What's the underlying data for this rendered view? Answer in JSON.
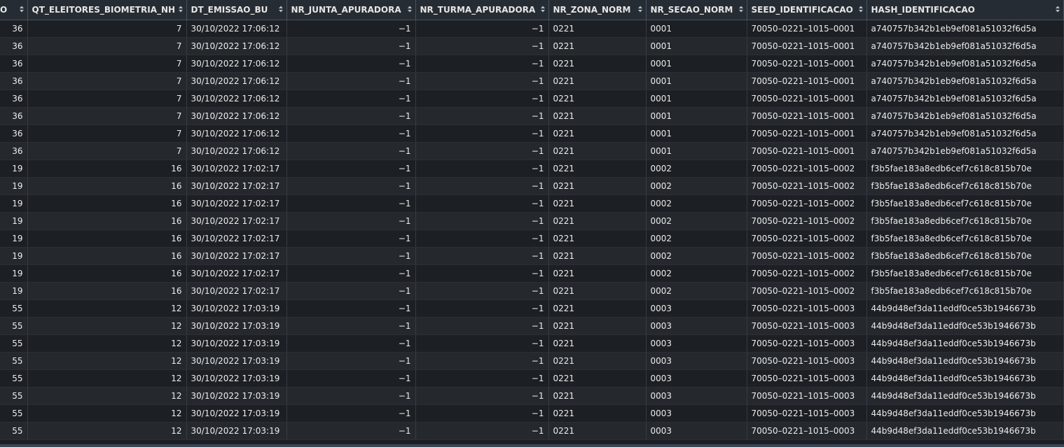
{
  "grid": {
    "columns": [
      {
        "label": "O"
      },
      {
        "label": "QT_ELEITORES_BIOMETRIA_NH"
      },
      {
        "label": "DT_EMISSAO_BU"
      },
      {
        "label": "NR_JUNTA_APURADORA"
      },
      {
        "label": "NR_TURMA_APURADORA"
      },
      {
        "label": "NR_ZONA_NORM"
      },
      {
        "label": "NR_SECAO_NORM"
      },
      {
        "label": "SEED_IDENTIFICACAO"
      },
      {
        "label": "HASH_IDENTIFICACAO"
      }
    ],
    "rows": [
      [
        "36",
        "7",
        "30/10/2022 17:06:12",
        "−1",
        "−1",
        "0221",
        "0001",
        "70050–0221–1015–0001",
        "a740757b342b1eb9ef081a51032f6d5a"
      ],
      [
        "36",
        "7",
        "30/10/2022 17:06:12",
        "−1",
        "−1",
        "0221",
        "0001",
        "70050–0221–1015–0001",
        "a740757b342b1eb9ef081a51032f6d5a"
      ],
      [
        "36",
        "7",
        "30/10/2022 17:06:12",
        "−1",
        "−1",
        "0221",
        "0001",
        "70050–0221–1015–0001",
        "a740757b342b1eb9ef081a51032f6d5a"
      ],
      [
        "36",
        "7",
        "30/10/2022 17:06:12",
        "−1",
        "−1",
        "0221",
        "0001",
        "70050–0221–1015–0001",
        "a740757b342b1eb9ef081a51032f6d5a"
      ],
      [
        "36",
        "7",
        "30/10/2022 17:06:12",
        "−1",
        "−1",
        "0221",
        "0001",
        "70050–0221–1015–0001",
        "a740757b342b1eb9ef081a51032f6d5a"
      ],
      [
        "36",
        "7",
        "30/10/2022 17:06:12",
        "−1",
        "−1",
        "0221",
        "0001",
        "70050–0221–1015–0001",
        "a740757b342b1eb9ef081a51032f6d5a"
      ],
      [
        "36",
        "7",
        "30/10/2022 17:06:12",
        "−1",
        "−1",
        "0221",
        "0001",
        "70050–0221–1015–0001",
        "a740757b342b1eb9ef081a51032f6d5a"
      ],
      [
        "36",
        "7",
        "30/10/2022 17:06:12",
        "−1",
        "−1",
        "0221",
        "0001",
        "70050–0221–1015–0001",
        "a740757b342b1eb9ef081a51032f6d5a"
      ],
      [
        "19",
        "16",
        "30/10/2022 17:02:17",
        "−1",
        "−1",
        "0221",
        "0002",
        "70050–0221–1015–0002",
        "f3b5fae183a8edb6cef7c618c815b70e"
      ],
      [
        "19",
        "16",
        "30/10/2022 17:02:17",
        "−1",
        "−1",
        "0221",
        "0002",
        "70050–0221–1015–0002",
        "f3b5fae183a8edb6cef7c618c815b70e"
      ],
      [
        "19",
        "16",
        "30/10/2022 17:02:17",
        "−1",
        "−1",
        "0221",
        "0002",
        "70050–0221–1015–0002",
        "f3b5fae183a8edb6cef7c618c815b70e"
      ],
      [
        "19",
        "16",
        "30/10/2022 17:02:17",
        "−1",
        "−1",
        "0221",
        "0002",
        "70050–0221–1015–0002",
        "f3b5fae183a8edb6cef7c618c815b70e"
      ],
      [
        "19",
        "16",
        "30/10/2022 17:02:17",
        "−1",
        "−1",
        "0221",
        "0002",
        "70050–0221–1015–0002",
        "f3b5fae183a8edb6cef7c618c815b70e"
      ],
      [
        "19",
        "16",
        "30/10/2022 17:02:17",
        "−1",
        "−1",
        "0221",
        "0002",
        "70050–0221–1015–0002",
        "f3b5fae183a8edb6cef7c618c815b70e"
      ],
      [
        "19",
        "16",
        "30/10/2022 17:02:17",
        "−1",
        "−1",
        "0221",
        "0002",
        "70050–0221–1015–0002",
        "f3b5fae183a8edb6cef7c618c815b70e"
      ],
      [
        "19",
        "16",
        "30/10/2022 17:02:17",
        "−1",
        "−1",
        "0221",
        "0002",
        "70050–0221–1015–0002",
        "f3b5fae183a8edb6cef7c618c815b70e"
      ],
      [
        "55",
        "12",
        "30/10/2022 17:03:19",
        "−1",
        "−1",
        "0221",
        "0003",
        "70050–0221–1015–0003",
        "44b9d48ef3da11eddf0ce53b1946673b"
      ],
      [
        "55",
        "12",
        "30/10/2022 17:03:19",
        "−1",
        "−1",
        "0221",
        "0003",
        "70050–0221–1015–0003",
        "44b9d48ef3da11eddf0ce53b1946673b"
      ],
      [
        "55",
        "12",
        "30/10/2022 17:03:19",
        "−1",
        "−1",
        "0221",
        "0003",
        "70050–0221–1015–0003",
        "44b9d48ef3da11eddf0ce53b1946673b"
      ],
      [
        "55",
        "12",
        "30/10/2022 17:03:19",
        "−1",
        "−1",
        "0221",
        "0003",
        "70050–0221–1015–0003",
        "44b9d48ef3da11eddf0ce53b1946673b"
      ],
      [
        "55",
        "12",
        "30/10/2022 17:03:19",
        "−1",
        "−1",
        "0221",
        "0003",
        "70050–0221–1015–0003",
        "44b9d48ef3da11eddf0ce53b1946673b"
      ],
      [
        "55",
        "12",
        "30/10/2022 17:03:19",
        "−1",
        "−1",
        "0221",
        "0003",
        "70050–0221–1015–0003",
        "44b9d48ef3da11eddf0ce53b1946673b"
      ],
      [
        "55",
        "12",
        "30/10/2022 17:03:19",
        "−1",
        "−1",
        "0221",
        "0003",
        "70050–0221–1015–0003",
        "44b9d48ef3da11eddf0ce53b1946673b"
      ],
      [
        "55",
        "12",
        "30/10/2022 17:03:19",
        "−1",
        "−1",
        "0221",
        "0003",
        "70050–0221–1015–0003",
        "44b9d48ef3da11eddf0ce53b1946673b"
      ]
    ]
  },
  "theme": {
    "background": "#1b1f23",
    "header_background": "#262c33",
    "row_odd": "#1c1f23",
    "row_even": "#25292e",
    "text": "#ececec"
  },
  "icons": {
    "sort": "sort-arrows-icon"
  }
}
